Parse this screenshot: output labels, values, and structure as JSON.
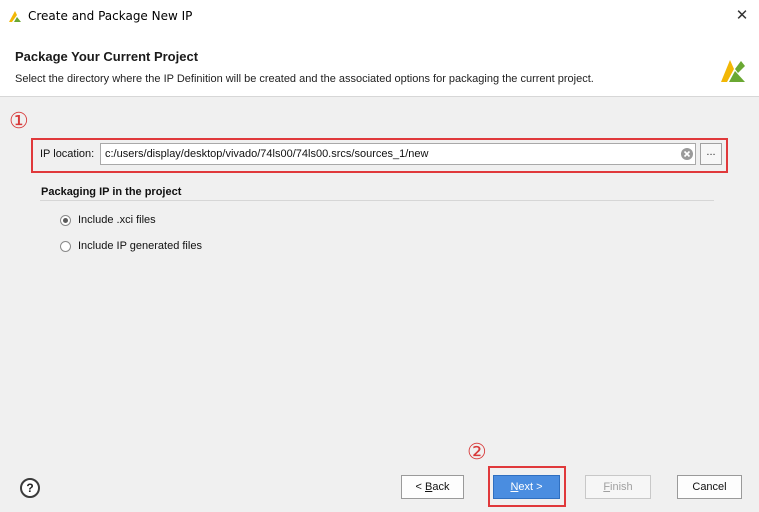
{
  "window": {
    "title": "Create and Package New IP"
  },
  "header": {
    "title": "Package Your Current Project",
    "subtitle": "Select the directory where the IP Definition will be created and the associated options for packaging the current project."
  },
  "annotations": {
    "marker_1": "①",
    "marker_2": "②",
    "highlight_color": "#e0393b"
  },
  "ip_location": {
    "label": "IP location:",
    "value": "c:/users/display/desktop/vivado/74ls00/74ls00.srcs/sources_1/new",
    "browse_label": "..."
  },
  "packaging": {
    "group_label": "Packaging IP in the project",
    "options": [
      {
        "label": "Include .xci files",
        "selected": true
      },
      {
        "label": "Include IP generated files",
        "selected": false
      }
    ]
  },
  "footer": {
    "help_label": "?",
    "back": {
      "pre": "< ",
      "mnemonic": "B",
      "post": "ack"
    },
    "next": {
      "mnemonic": "N",
      "post": "ext >"
    },
    "finish": {
      "mnemonic": "F",
      "post": "inish"
    },
    "cancel": "Cancel"
  },
  "colors": {
    "accent": "#4a8de0",
    "brand_yellow": "#f2b705",
    "brand_green": "#6aa832"
  }
}
